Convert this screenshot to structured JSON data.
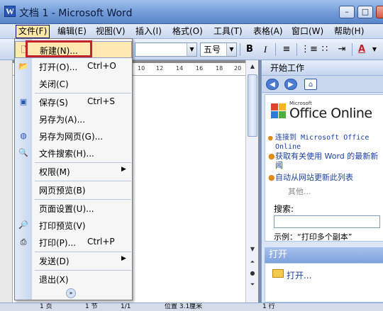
{
  "window": {
    "title": "文档 1 - Microsoft Word",
    "app_icon": "W",
    "minimize": "–",
    "maximize": "□",
    "close": "✕"
  },
  "menubar": {
    "items": [
      {
        "label": "文件(F)",
        "active": true
      },
      {
        "label": "编辑(E)"
      },
      {
        "label": "视图(V)"
      },
      {
        "label": "插入(I)"
      },
      {
        "label": "格式(O)"
      },
      {
        "label": "工具(T)"
      },
      {
        "label": "表格(A)"
      },
      {
        "label": "窗口(W)"
      },
      {
        "label": "帮助(H)"
      }
    ]
  },
  "toolbar": {
    "font_size": "五号",
    "bold": "B",
    "italic": "I",
    "font_color": "A"
  },
  "ruler": {
    "labels": [
      "10",
      "12",
      "14",
      "16",
      "18",
      "20"
    ]
  },
  "file_menu": {
    "items": [
      {
        "label": "新建(N)...",
        "shortcut": "",
        "icon": "new-document-icon",
        "selected": true
      },
      {
        "label": "打开(O)...",
        "shortcut": "Ctrl+O",
        "icon": "open-folder-icon"
      },
      {
        "label": "关闭(C)",
        "shortcut": "",
        "icon": ""
      },
      {
        "label": "保存(S)",
        "shortcut": "Ctrl+S",
        "icon": "save-disk-icon"
      },
      {
        "label": "另存为(A)...",
        "shortcut": "",
        "icon": ""
      },
      {
        "label": "另存为网页(G)...",
        "shortcut": "",
        "icon": "web-page-icon"
      },
      {
        "label": "文件搜索(H)...",
        "shortcut": "",
        "icon": "file-search-icon"
      },
      {
        "label": "权限(M)",
        "shortcut": "",
        "icon": "",
        "submenu": true
      },
      {
        "label": "网页预览(B)",
        "shortcut": "",
        "icon": ""
      },
      {
        "label": "页面设置(U)...",
        "shortcut": "",
        "icon": ""
      },
      {
        "label": "打印预览(V)",
        "shortcut": "",
        "icon": "print-preview-icon"
      },
      {
        "label": "打印(P)...",
        "shortcut": "Ctrl+P",
        "icon": "printer-icon"
      },
      {
        "label": "发送(D)",
        "shortcut": "",
        "icon": "",
        "submenu": true
      },
      {
        "label": "退出(X)",
        "shortcut": "",
        "icon": ""
      }
    ],
    "expand_glyph": "»"
  },
  "task_pane": {
    "title": "开始工作",
    "brand_small": "Microsoft",
    "brand": "Office Online",
    "links": [
      "连接到 Microsoft Office Online",
      "获取有关使用 Word 的最新新闻",
      "自动从网站更新此列表"
    ],
    "more": "其他...",
    "search_label": "搜索:",
    "search_value": "",
    "example": "示例：“打印多个副本”",
    "open_section": "打开",
    "open_link": "打开..."
  },
  "statusbar": {
    "page": "1 页",
    "section": "1 节",
    "page_of": "1/1",
    "position": "位置 3.1厘米",
    "line": "1 行"
  },
  "colors": {
    "accent": "#2b57b3",
    "highlight_box": "#c0242a",
    "selected_item": "#ffe9b0"
  }
}
